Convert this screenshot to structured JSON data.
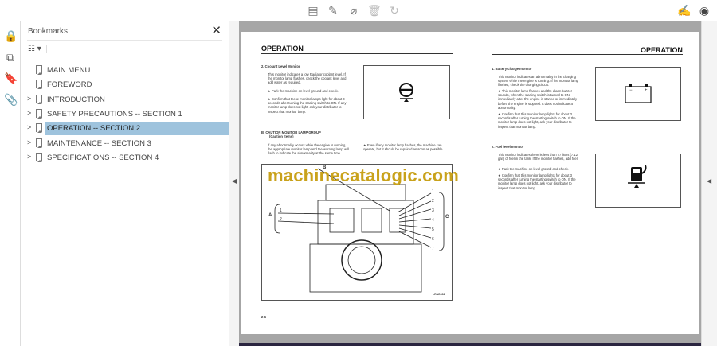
{
  "toolbar": {
    "icons": [
      "comment-icon",
      "pen-icon",
      "highlight-clear-icon",
      "trash-icon",
      "redo-icon",
      "sign-icon",
      "account-icon"
    ]
  },
  "rail": {
    "icons": [
      "lock-icon",
      "pages-icon",
      "bookmark-icon",
      "attachment-icon"
    ]
  },
  "bookmarks": {
    "title": "Bookmarks",
    "items": [
      {
        "label": "MAIN MENU",
        "expandable": false
      },
      {
        "label": "FOREWORD",
        "expandable": false
      },
      {
        "label": "INTRODUCTION",
        "expandable": true
      },
      {
        "label": "SAFETY PRECAUTIONS -- SECTION 1",
        "expandable": true
      },
      {
        "label": "OPERATION -- SECTION 2",
        "expandable": true,
        "selected": true
      },
      {
        "label": "MAINTENANCE -- SECTION 3",
        "expandable": true
      },
      {
        "label": "SPECIFICATIONS -- SECTION 4",
        "expandable": true
      }
    ]
  },
  "left_page": {
    "header": "OPERATION",
    "s1_title": "2.  Coolant Level Monitor",
    "s1_body": "This monitor indicates a low Radiator coolant level. If the monitor lamp flashes, check the coolant level and add water as required.",
    "s1_b1": "Park the machine on level ground and check.",
    "s1_b2": "Confirm that these monitor lamps light for about 3 seconds after turning the starting switch to ON. If any monitor lamp does not light, ask your distributor to inspect that monitor lamp.",
    "s2_title": "B.  CAUTION MONITOR LAMP GROUP",
    "s2_sub": "(Caution items)",
    "s2_body": "If any abnormality occurs while the engine is running, the appropriate monitor lamp and the warning lamp will flash to indicate the abnormality at the same time.",
    "s2_b1": "Even if any monitor lamp flashes, the machine can operate, but it should be repaired as soon as possible.",
    "diagram_labels": {
      "A": "A",
      "B": "B",
      "C": "C",
      "left": [
        "1",
        "2"
      ],
      "right": [
        "1",
        "2",
        "3",
        "4",
        "5",
        "6",
        "7"
      ],
      "code": "LRAD036"
    },
    "page_number": "2-6",
    "watermark": "machinecatalogic.com"
  },
  "right_page": {
    "header": "OPERATION",
    "s1_title": "1.  Battery charge monitor",
    "s1_body": "This monitor indicates an abnormality in the charging system while the engine is running. If the monitor lamp flashes, check the charging circuit.",
    "s1_b1": "This monitor lamp flashes and the alarm buzzer sounds, when the starting switch is turned to ON immediately after the engine is started or immediately before the engine is stopped. It does not indicate a abnormality.",
    "s1_b2": "Confirm that this monitor lamp lights for about 3 seconds after turning the starting switch to ON. If the monitor lamp does not light, ask your distributor to inspect that monitor lamp.",
    "s2_title": "2.  Fuel level monitor",
    "s2_body": "This monitor indicates there is less than 27 liters (7.12 gal.) of fuel in the tank. If the monitor flashes, add fuel.",
    "s2_b1": "Park the machine on level ground and check.",
    "s2_b2": "Confirm that this monitor lamp lights for about 3 seconds after turning the starting switch to ON. If the monitor lamp does not light, ask your distributor to inspect that monitor lamp.",
    "battery_minus": "−",
    "battery_plus": "+"
  },
  "colors": {
    "selection": "#9ec3dd",
    "watermark": "#c9a21b",
    "doc_background": "#a6a6a6"
  }
}
